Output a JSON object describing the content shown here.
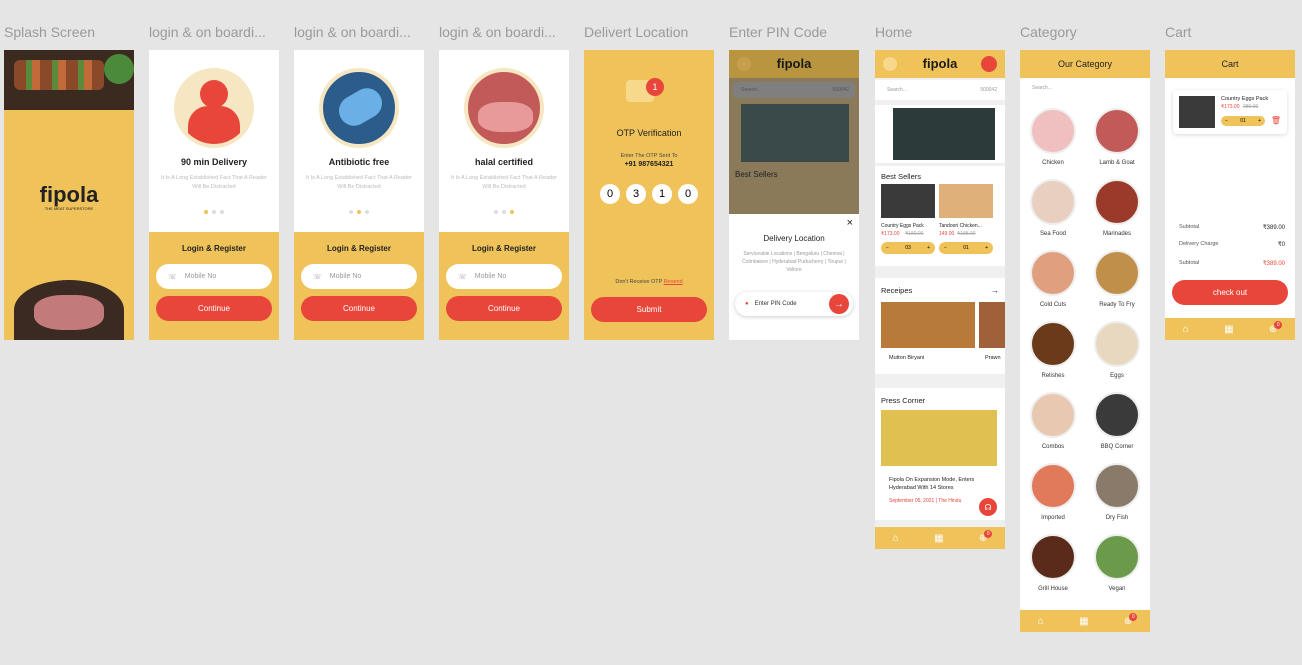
{
  "frames": {
    "splash": {
      "label": "Splash Screen",
      "logo": "fipola",
      "tagline": "THE MEAT SUPERSTORE"
    },
    "onboarding": [
      {
        "label": "login & on boardi...",
        "title": "90 min Delivery",
        "desc": "It Is A Long Established Fact That A Reader Will Be Distracted",
        "active_dot": 0
      },
      {
        "label": "login & on boardi...",
        "title": "Antibiotic free",
        "desc": "It Is A Long Established Fact That A Reader Will Be Distracted",
        "active_dot": 1
      },
      {
        "label": "login & on boardi...",
        "title": "halal certified",
        "desc": "It Is A Long Established Fact That A Reader Will Be Distracted",
        "active_dot": 2
      }
    ],
    "login": {
      "heading": "Login & Register",
      "mobile_placeholder": "Mobile No",
      "continue": "Continue"
    },
    "otp": {
      "label": "Delivert Location",
      "title": "OTP Verification",
      "sent_to": "Enter The OTP Sent To",
      "phone": "+91 987654321",
      "digits": [
        "0",
        "3",
        "1",
        "0"
      ],
      "resend_prefix": "Don't Receive OTP",
      "resend": "Resend",
      "submit": "Submit"
    },
    "pin": {
      "label": "Enter PIN Code",
      "search": "Search...",
      "pin_value": "500042",
      "best_sellers": "Best Sellers",
      "modal_title": "Delivery Location",
      "modal_desc": "Serviceable Locations | Bengaluru | Chennai | Coimbatore | Hyderabad Puducherry | Tirupur | Vellore",
      "placeholder": "Enter PIN Code",
      "close": "×"
    },
    "home": {
      "label": "Home",
      "logo": "fipola",
      "search": "Search...",
      "pin_value": "500042",
      "best_sellers": "Best Sellers",
      "products": [
        {
          "name": "Country Eggs Pack",
          "price": "₹173.00",
          "old": "₹180.00",
          "qty": "03"
        },
        {
          "name": "Tandoori Chicken...",
          "price": "149.00",
          "old": "₹188.00",
          "qty": "01"
        }
      ],
      "recipes": "Receipes",
      "recipe_items": [
        "Mutton Biryani",
        "Prawn"
      ],
      "press": "Press Corner",
      "press_title": "Fipola On Expansion Mode, Enters Hyderabad With 14 Stores",
      "press_meta": "September 05, 2021 | The Hindu",
      "cart_count": "0"
    },
    "category": {
      "label": "Category",
      "title": "Our Category",
      "search": "Search...",
      "items": [
        "Chicken",
        "Lamb & Goat",
        "Sea Food",
        "Marinades",
        "Cold Cuts",
        "Ready To Fry",
        "Relishes",
        "Eggs",
        "Combos",
        "BBQ Corner",
        "Imported",
        "Dry Fish",
        "Grill House",
        "Vegan"
      ],
      "cart_count": "0"
    },
    "cart": {
      "label": "Cart",
      "title": "Cart",
      "item_name": "Country Eggs Pack",
      "item_price": "₹173.00",
      "item_old": "280.00",
      "item_qty": "01",
      "subtotal_label": "Subtotal",
      "subtotal": "₹389.00",
      "delivery_label": "Delivery Charge",
      "delivery": "₹0",
      "total_label": "Subtotal",
      "total": "₹389.00",
      "checkout": "check out",
      "cart_count": "0"
    }
  },
  "colors": {
    "yellow": "#f0c35a",
    "red": "#e8463a",
    "bg": "#e5e5e5"
  }
}
